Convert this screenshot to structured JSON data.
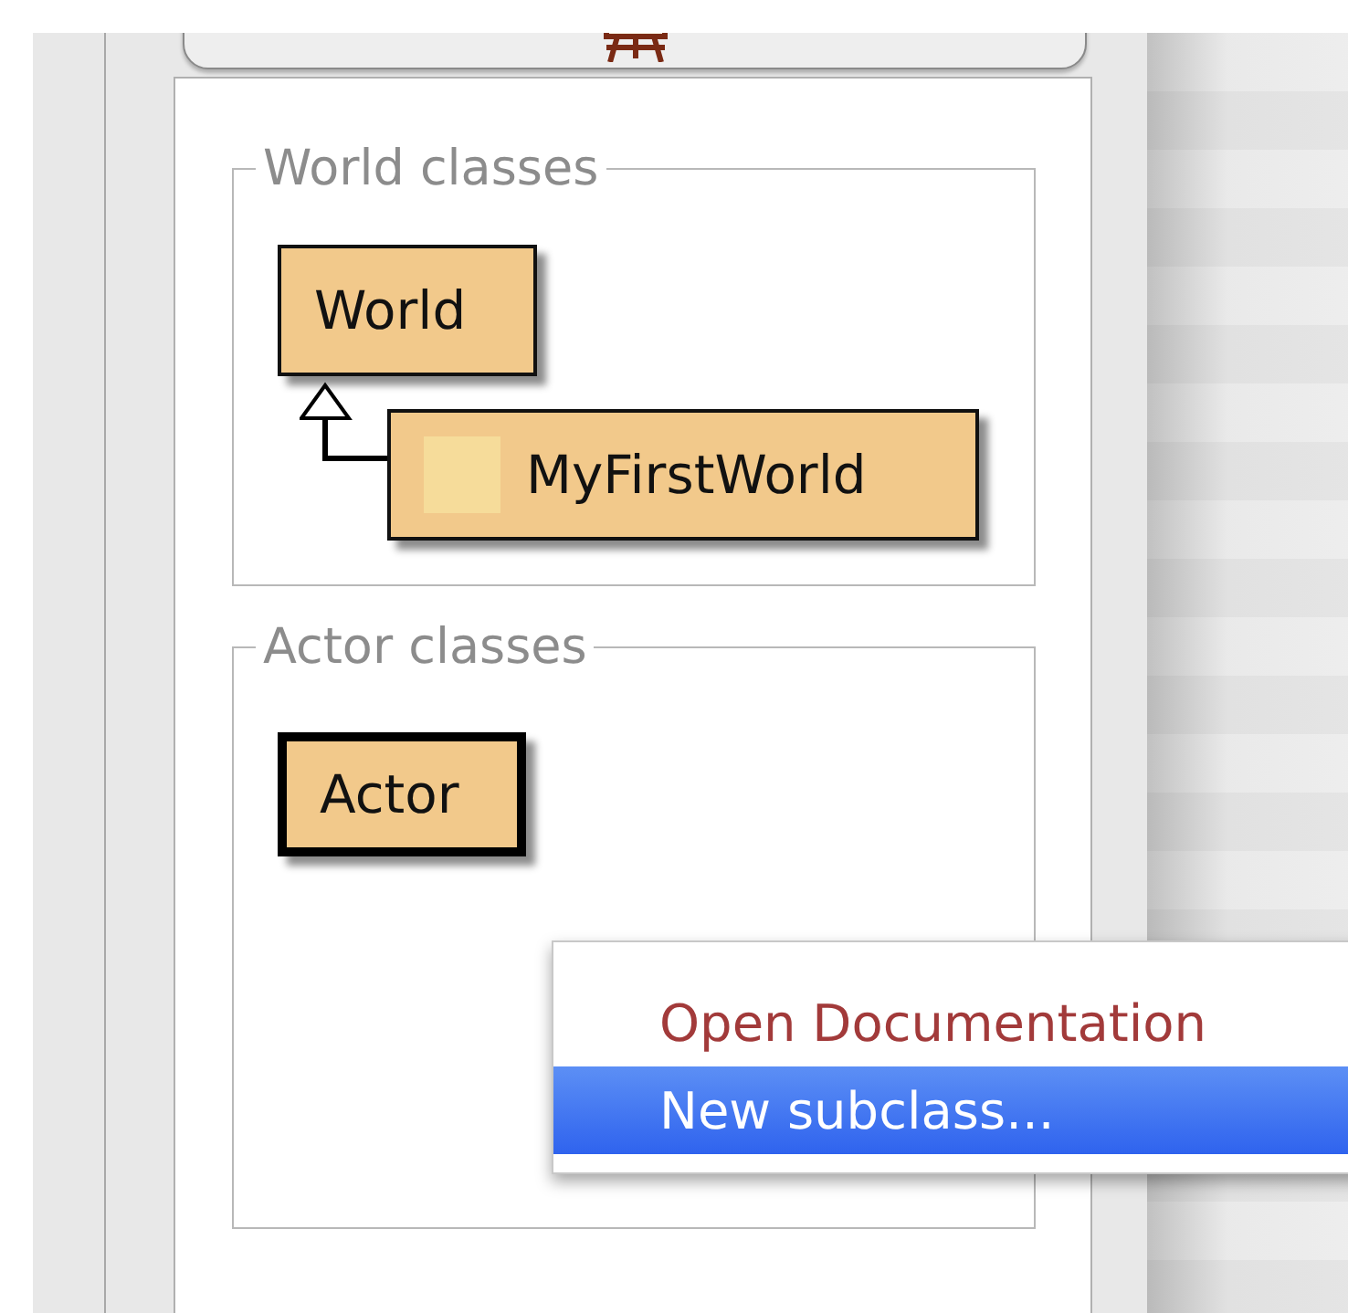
{
  "world_classes": {
    "title": "World classes",
    "classes": [
      {
        "name": "World",
        "selected": false,
        "has_image": false,
        "children": [
          {
            "name": "MyFirstWorld",
            "selected": false,
            "has_image": true
          }
        ]
      }
    ]
  },
  "actor_classes": {
    "title": "Actor classes",
    "classes": [
      {
        "name": "Actor",
        "selected": true,
        "has_image": false
      }
    ]
  },
  "context_menu": {
    "items": [
      {
        "label": "Open Documentation",
        "kind": "documentation",
        "selected": false
      },
      {
        "label": "New subclass...",
        "kind": "command",
        "selected": true
      }
    ]
  }
}
